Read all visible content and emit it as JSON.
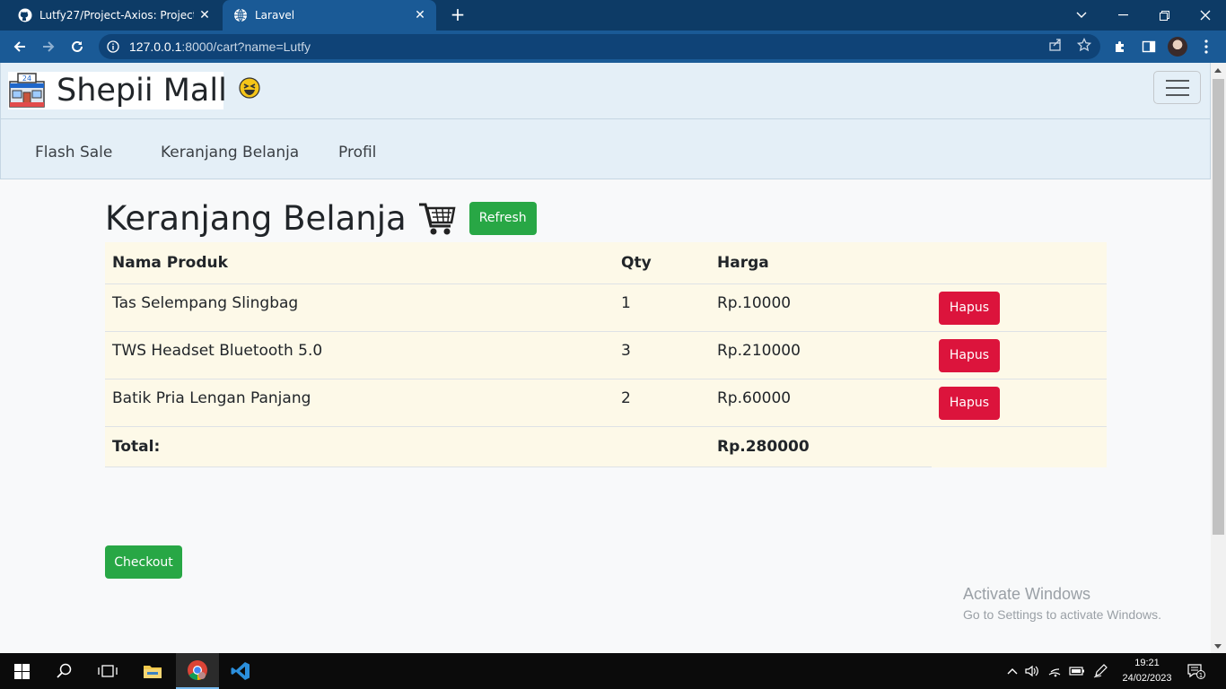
{
  "browser": {
    "tabs": [
      {
        "title": "Lutfy27/Project-Axios: Project Axios",
        "icon": "github-icon",
        "active": false
      },
      {
        "title": "Laravel",
        "icon": "globe-icon",
        "active": true
      }
    ],
    "url_host": "127.0.0.1",
    "url_rest": ":8000/cart?name=Lutfy"
  },
  "site": {
    "brand": "Shepii Mall",
    "hamburger_icon": "hamburger-icon",
    "nav": [
      "Flash Sale",
      "Keranjang Belanja",
      "Profil"
    ]
  },
  "cart": {
    "title": "Keranjang Belanja",
    "refresh_label": "Refresh",
    "headers": {
      "name": "Nama Produk",
      "qty": "Qty",
      "price": "Harga"
    },
    "items": [
      {
        "name": "Tas Selempang Slingbag",
        "qty": "1",
        "price": "Rp.10000",
        "action": "Hapus"
      },
      {
        "name": "TWS Headset Bluetooth 5.0",
        "qty": "3",
        "price": "Rp.210000",
        "action": "Hapus"
      },
      {
        "name": "Batik Pria Lengan Panjang",
        "qty": "2",
        "price": "Rp.60000",
        "action": "Hapus"
      }
    ],
    "total_label": "Total:",
    "total_value": "Rp.280000",
    "checkout_label": "Checkout"
  },
  "watermark": {
    "line1": "Activate Windows",
    "line2": "Go to Settings to activate Windows."
  },
  "taskbar": {
    "time": "19:21",
    "date": "24/02/2023",
    "notification_count": "1"
  },
  "colors": {
    "browser_frame": "#0d3b66",
    "browser_toolbar": "#1a5a96",
    "navbar_bg": "#e4eff7",
    "table_bg": "#fdf9e8",
    "button_green": "#28a745",
    "button_red": "#dc143c"
  }
}
